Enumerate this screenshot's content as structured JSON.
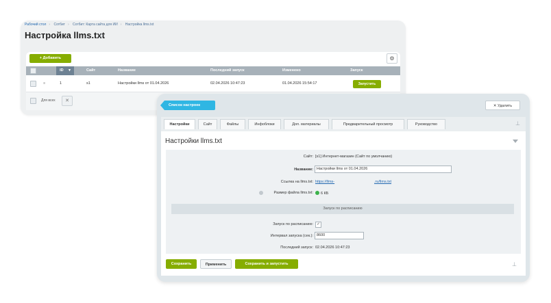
{
  "list_window": {
    "breadcrumbs": [
      "Рабочий стол",
      "Сотбит",
      "Сотбит: Карта сайта для ИИ",
      "Настройка llms.txt"
    ],
    "breadcrumb_sep": "›",
    "title": "Настройка llms.txt",
    "star_icon": "☆",
    "add_button": "+ Добавить",
    "settings_icon": "⚙",
    "columns": {
      "id": "ID",
      "site": "Сайт",
      "name": "Название",
      "last_run": "Последний запуск",
      "changed": "Изменено",
      "run": "Запуск"
    },
    "sort_icon": "▾",
    "rows": [
      {
        "id": "1",
        "site": "s1",
        "name": "Настройки llms от 01.04.2026",
        "last_run": "02.04.2026 10:47:23",
        "changed": "01.04.2026 15:54:17",
        "run_button": "Запустить"
      }
    ],
    "row_menu_icon": "≡",
    "for_all_label": "Для всех",
    "delete_selected_icon": "✕"
  },
  "settings_window": {
    "list_button": "Список настроек",
    "delete_button": "✕ Удалить",
    "tabs": [
      "Настройки",
      "Сайт",
      "Файлы",
      "Инфоблоки",
      "Доп. материалы",
      "Предварительный просмотр",
      "Руководство"
    ],
    "active_tab": "Настройки",
    "section_title": "Настройки llms.txt",
    "pin_icon": "⊥",
    "fields": {
      "site_label": "Сайт:",
      "site_value": "[s1] Интернет-магазин (Сайт по умолчанию)",
      "name_label": "Название:",
      "name_value": "Настройки llms от 01.04.2026",
      "link_label": "Ссылка на llms.txt:",
      "link_value_start": "https://llms-",
      "link_value_end": ".ru/llms.txt",
      "size_label": "Размер файла llms.txt:",
      "size_value": "6 КБ"
    },
    "schedule": {
      "header": "Запуск по расписанию",
      "enabled_label": "Запуск по расписанию:",
      "enabled_mark": "✓",
      "interval_label": "Интервал запуска (сек.):",
      "interval_value": "8600",
      "last_run_label": "Последний запуск:",
      "last_run_value": "02.04.2026 10:47:23"
    },
    "buttons": {
      "save": "Сохранить",
      "apply": "Применить",
      "save_run": "Сохранить и запустить"
    }
  },
  "colors": {
    "accent_green": "#86ad00",
    "accent_blue": "#2fb6e3",
    "status_green": "#3bb24a"
  }
}
